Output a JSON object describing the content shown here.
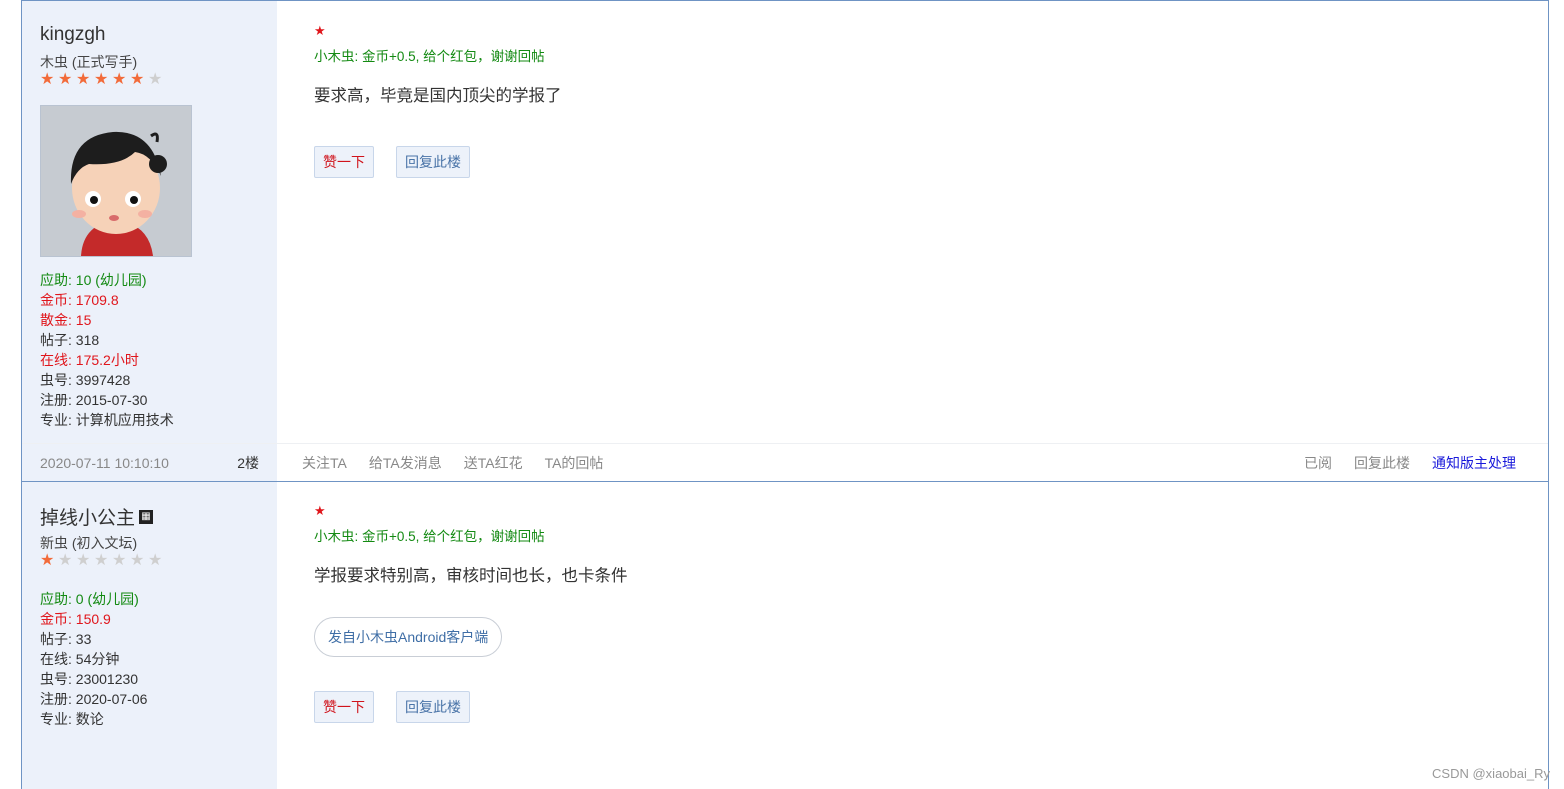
{
  "post1": {
    "username": "kingzgh",
    "rank": "木虫 (正式写手)",
    "stars_on": 6,
    "stars_total": 7,
    "stats": [
      {
        "text": "应助: 10 (幼儿园)",
        "color": "green"
      },
      {
        "text": "金币: 1709.8",
        "color": "red"
      },
      {
        "text": "散金: 15",
        "color": "red"
      },
      {
        "text": "帖子: 318",
        "color": "dark"
      },
      {
        "text": "在线: 175.2小时",
        "color": "red"
      },
      {
        "text": "虫号: 3997428",
        "color": "dark"
      },
      {
        "text": "注册: 2015-07-30",
        "color": "dark"
      },
      {
        "text": "专业: 计算机应用技术",
        "color": "dark"
      }
    ],
    "flower": "★",
    "bonus": "小木虫: 金币+0.5, 给个红包，谢谢回帖",
    "content": "要求高，毕竟是国内顶尖的学报了",
    "like_label": "赞一下",
    "reply_label": "回复此楼",
    "time": "2020-07-11 10:10:10",
    "floor": "2楼",
    "footer_links": [
      "关注TA",
      "给TA发消息",
      "送TA红花",
      "TA的回帖"
    ],
    "footer_right": [
      "已阅",
      "回复此楼",
      "通知版主处理"
    ]
  },
  "post2": {
    "username": "掉线小公主",
    "badge": "▦",
    "rank": "新虫 (初入文坛)",
    "stars_on": 1,
    "stars_total": 7,
    "stats": [
      {
        "text": "应助: 0 (幼儿园)",
        "color": "green"
      },
      {
        "text": "金币: 150.9",
        "color": "red"
      },
      {
        "text": "帖子: 33",
        "color": "dark"
      },
      {
        "text": "在线: 54分钟",
        "color": "dark"
      },
      {
        "text": "虫号: 23001230",
        "color": "dark"
      },
      {
        "text": "注册: 2020-07-06",
        "color": "dark"
      },
      {
        "text": "专业: 数论",
        "color": "dark"
      }
    ],
    "flower": "★",
    "bonus": "小木虫: 金币+0.5, 给个红包，谢谢回帖",
    "content": "学报要求特别高，审核时间也长，也卡条件",
    "client_tag": "发自小木虫Android客户端",
    "like_label": "赞一下",
    "reply_label": "回复此楼"
  },
  "watermark": "CSDN @xiaobai_Ry",
  "colors": {
    "border": "#6f94c4",
    "sidebar": "#ecf1fa",
    "green": "#138a12",
    "red": "#e0161c",
    "link": "#1a1adb"
  }
}
